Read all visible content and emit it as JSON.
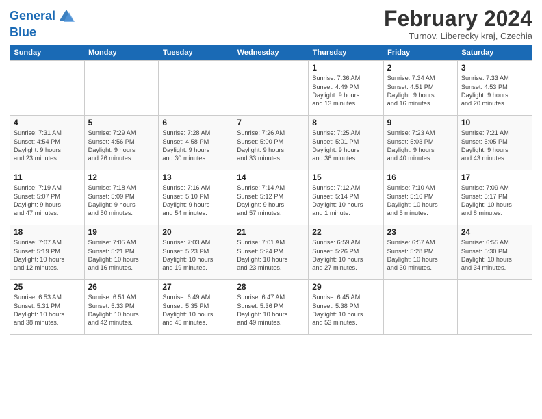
{
  "header": {
    "logo_line1": "General",
    "logo_line2": "Blue",
    "month_title": "February 2024",
    "location": "Turnov, Liberecky kraj, Czechia"
  },
  "weekdays": [
    "Sunday",
    "Monday",
    "Tuesday",
    "Wednesday",
    "Thursday",
    "Friday",
    "Saturday"
  ],
  "weeks": [
    [
      {
        "day": "",
        "info": ""
      },
      {
        "day": "",
        "info": ""
      },
      {
        "day": "",
        "info": ""
      },
      {
        "day": "",
        "info": ""
      },
      {
        "day": "1",
        "info": "Sunrise: 7:36 AM\nSunset: 4:49 PM\nDaylight: 9 hours\nand 13 minutes."
      },
      {
        "day": "2",
        "info": "Sunrise: 7:34 AM\nSunset: 4:51 PM\nDaylight: 9 hours\nand 16 minutes."
      },
      {
        "day": "3",
        "info": "Sunrise: 7:33 AM\nSunset: 4:53 PM\nDaylight: 9 hours\nand 20 minutes."
      }
    ],
    [
      {
        "day": "4",
        "info": "Sunrise: 7:31 AM\nSunset: 4:54 PM\nDaylight: 9 hours\nand 23 minutes."
      },
      {
        "day": "5",
        "info": "Sunrise: 7:29 AM\nSunset: 4:56 PM\nDaylight: 9 hours\nand 26 minutes."
      },
      {
        "day": "6",
        "info": "Sunrise: 7:28 AM\nSunset: 4:58 PM\nDaylight: 9 hours\nand 30 minutes."
      },
      {
        "day": "7",
        "info": "Sunrise: 7:26 AM\nSunset: 5:00 PM\nDaylight: 9 hours\nand 33 minutes."
      },
      {
        "day": "8",
        "info": "Sunrise: 7:25 AM\nSunset: 5:01 PM\nDaylight: 9 hours\nand 36 minutes."
      },
      {
        "day": "9",
        "info": "Sunrise: 7:23 AM\nSunset: 5:03 PM\nDaylight: 9 hours\nand 40 minutes."
      },
      {
        "day": "10",
        "info": "Sunrise: 7:21 AM\nSunset: 5:05 PM\nDaylight: 9 hours\nand 43 minutes."
      }
    ],
    [
      {
        "day": "11",
        "info": "Sunrise: 7:19 AM\nSunset: 5:07 PM\nDaylight: 9 hours\nand 47 minutes."
      },
      {
        "day": "12",
        "info": "Sunrise: 7:18 AM\nSunset: 5:09 PM\nDaylight: 9 hours\nand 50 minutes."
      },
      {
        "day": "13",
        "info": "Sunrise: 7:16 AM\nSunset: 5:10 PM\nDaylight: 9 hours\nand 54 minutes."
      },
      {
        "day": "14",
        "info": "Sunrise: 7:14 AM\nSunset: 5:12 PM\nDaylight: 9 hours\nand 57 minutes."
      },
      {
        "day": "15",
        "info": "Sunrise: 7:12 AM\nSunset: 5:14 PM\nDaylight: 10 hours\nand 1 minute."
      },
      {
        "day": "16",
        "info": "Sunrise: 7:10 AM\nSunset: 5:16 PM\nDaylight: 10 hours\nand 5 minutes."
      },
      {
        "day": "17",
        "info": "Sunrise: 7:09 AM\nSunset: 5:17 PM\nDaylight: 10 hours\nand 8 minutes."
      }
    ],
    [
      {
        "day": "18",
        "info": "Sunrise: 7:07 AM\nSunset: 5:19 PM\nDaylight: 10 hours\nand 12 minutes."
      },
      {
        "day": "19",
        "info": "Sunrise: 7:05 AM\nSunset: 5:21 PM\nDaylight: 10 hours\nand 16 minutes."
      },
      {
        "day": "20",
        "info": "Sunrise: 7:03 AM\nSunset: 5:23 PM\nDaylight: 10 hours\nand 19 minutes."
      },
      {
        "day": "21",
        "info": "Sunrise: 7:01 AM\nSunset: 5:24 PM\nDaylight: 10 hours\nand 23 minutes."
      },
      {
        "day": "22",
        "info": "Sunrise: 6:59 AM\nSunset: 5:26 PM\nDaylight: 10 hours\nand 27 minutes."
      },
      {
        "day": "23",
        "info": "Sunrise: 6:57 AM\nSunset: 5:28 PM\nDaylight: 10 hours\nand 30 minutes."
      },
      {
        "day": "24",
        "info": "Sunrise: 6:55 AM\nSunset: 5:30 PM\nDaylight: 10 hours\nand 34 minutes."
      }
    ],
    [
      {
        "day": "25",
        "info": "Sunrise: 6:53 AM\nSunset: 5:31 PM\nDaylight: 10 hours\nand 38 minutes."
      },
      {
        "day": "26",
        "info": "Sunrise: 6:51 AM\nSunset: 5:33 PM\nDaylight: 10 hours\nand 42 minutes."
      },
      {
        "day": "27",
        "info": "Sunrise: 6:49 AM\nSunset: 5:35 PM\nDaylight: 10 hours\nand 45 minutes."
      },
      {
        "day": "28",
        "info": "Sunrise: 6:47 AM\nSunset: 5:36 PM\nDaylight: 10 hours\nand 49 minutes."
      },
      {
        "day": "29",
        "info": "Sunrise: 6:45 AM\nSunset: 5:38 PM\nDaylight: 10 hours\nand 53 minutes."
      },
      {
        "day": "",
        "info": ""
      },
      {
        "day": "",
        "info": ""
      }
    ]
  ]
}
